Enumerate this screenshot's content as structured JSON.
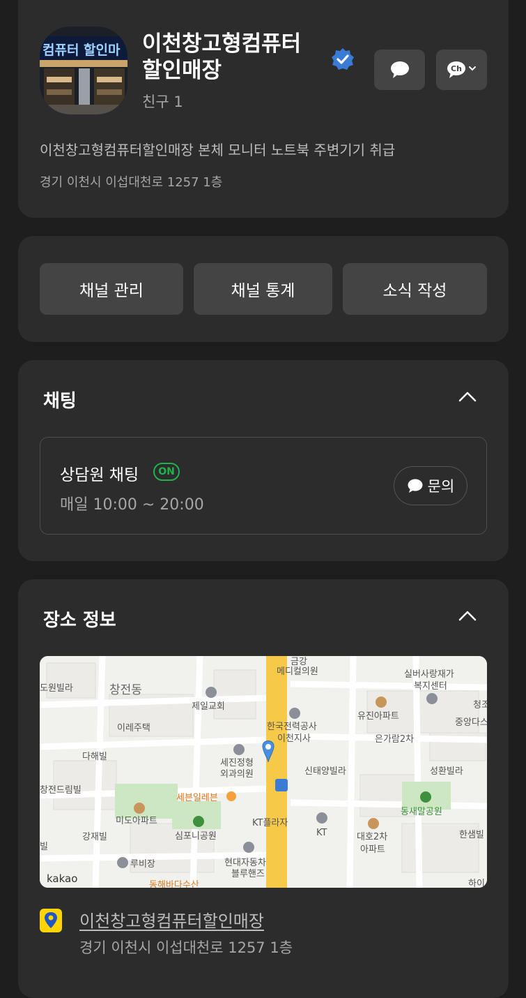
{
  "profile": {
    "title": "이천창고형컴퓨터할인매장",
    "title_line1": "이천창고형컴퓨터",
    "title_line2": "할인매장",
    "friends": "친구 1",
    "description": "이천창고형컴퓨터할인매장 본체 모니터 노트북 주변기기 취급",
    "address": "경기 이천시 이섭대천로 1257 1층",
    "avatar_sign_text": "컴퓨터 할인마",
    "channel_button_text": "Ch",
    "verified_color": "#3a7bd5"
  },
  "actions": [
    {
      "label": "채널 관리"
    },
    {
      "label": "채널 통계"
    },
    {
      "label": "소식 작성"
    }
  ],
  "chat_section": {
    "title": "채팅",
    "name": "상담원 채팅",
    "status_badge": "ON",
    "hours": "매일 10:00 ~ 20:00",
    "inquiry_label": "문의",
    "badge_color": "#1fb34b"
  },
  "place_section": {
    "title": "장소 정보",
    "place_name": "이천창고형컴퓨터할인매장",
    "address": "경기 이천시 이섭대천로 1257 1층",
    "pin_color": "#ffd400"
  },
  "map": {
    "labels": [
      "금강",
      "메디컬의원",
      "실버사랑재가",
      "복지센터",
      "도원빌라",
      "창전동",
      "제일교회",
      "청조",
      "유진아파트",
      "중앙다스",
      "이레주택",
      "한국전력공사",
      "이천지사",
      "은가람2차",
      "다해빌",
      "세진정형",
      "외과의원",
      "신태양빌라",
      "성환빌라",
      "창전드림빌",
      "세븐일레븐",
      "동새말공원",
      "미도아파트",
      "KT플라자",
      "KT",
      "대호2차",
      "아파트",
      "강재빌",
      "심포니공원",
      "한샘빌",
      "빌",
      "루비장",
      "현대자동차",
      "블루핸즈",
      "kakao",
      "동해바다수산",
      "하이"
    ]
  }
}
